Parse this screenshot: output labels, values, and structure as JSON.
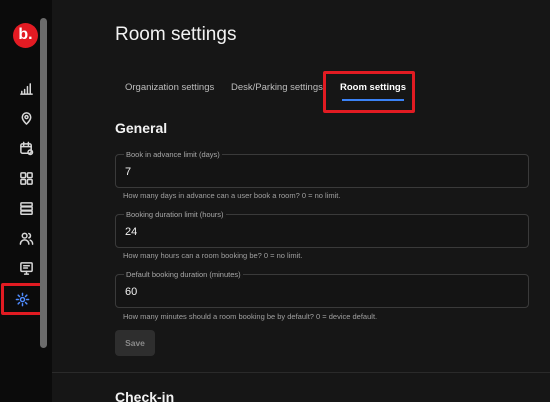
{
  "sidebar": {
    "logo_text": "b.",
    "brand_color": "#e31b23",
    "active_color": "#4f8cff",
    "items": [
      {
        "icon": "chart-icon"
      },
      {
        "icon": "location-icon"
      },
      {
        "icon": "calendar-icon"
      },
      {
        "icon": "grid-icon"
      },
      {
        "icon": "list-icon"
      },
      {
        "icon": "users-icon"
      },
      {
        "icon": "display-icon"
      },
      {
        "icon": "gear-icon",
        "active": true
      }
    ]
  },
  "page": {
    "title": "Room settings"
  },
  "tabs": [
    {
      "label": "Organization settings"
    },
    {
      "label": "Desk/Parking settings"
    },
    {
      "label": "Room settings",
      "active": true
    }
  ],
  "general": {
    "title": "General",
    "fields": [
      {
        "label": "Book in advance limit (days)",
        "value": "7",
        "helper": "How many days in advance can a user book a room? 0 = no limit."
      },
      {
        "label": "Booking duration limit (hours)",
        "value": "24",
        "helper": "How many hours can a room booking be? 0 = no limit."
      },
      {
        "label": "Default booking duration (minutes)",
        "value": "60",
        "helper": "How many minutes should a room booking be by default? 0 = device default."
      }
    ],
    "save_label": "Save"
  },
  "checkin": {
    "title": "Check-in"
  }
}
